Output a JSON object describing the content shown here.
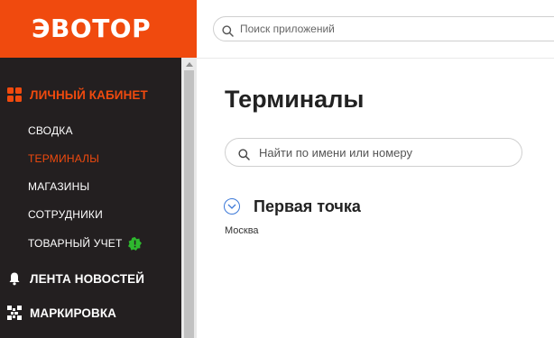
{
  "brand": {
    "logo_text": "ЭВОТОР",
    "accent_color": "#f04a0e",
    "sidebar_color": "#231f20"
  },
  "top_search": {
    "placeholder": "Поиск приложений",
    "value": ""
  },
  "sidebar": {
    "sections": [
      {
        "label": "ЛИЧНЫЙ КАБИНЕТ",
        "icon": "grid-icon",
        "active": true
      },
      {
        "label": "ЛЕНТА НОВОСТЕЙ",
        "icon": "bell-icon",
        "active": false
      },
      {
        "label": "МАРКИРОВКА",
        "icon": "qr-icon",
        "active": false
      }
    ],
    "items": [
      {
        "label": "СВОДКА",
        "active": false
      },
      {
        "label": "ТЕРМИНАЛЫ",
        "active": true
      },
      {
        "label": "МАГАЗИНЫ",
        "active": false
      },
      {
        "label": "СОТРУДНИКИ",
        "active": false
      },
      {
        "label": "ТОВАРНЫЙ УЧЕТ",
        "active": false,
        "badge": "!",
        "badge_color": "#2eb82e"
      }
    ]
  },
  "main": {
    "title": "Терминалы",
    "search": {
      "placeholder": "Найти по имени или номеру",
      "value": ""
    },
    "groups": [
      {
        "title": "Первая точка",
        "subtitle": "Москва",
        "expanded": true
      }
    ]
  }
}
